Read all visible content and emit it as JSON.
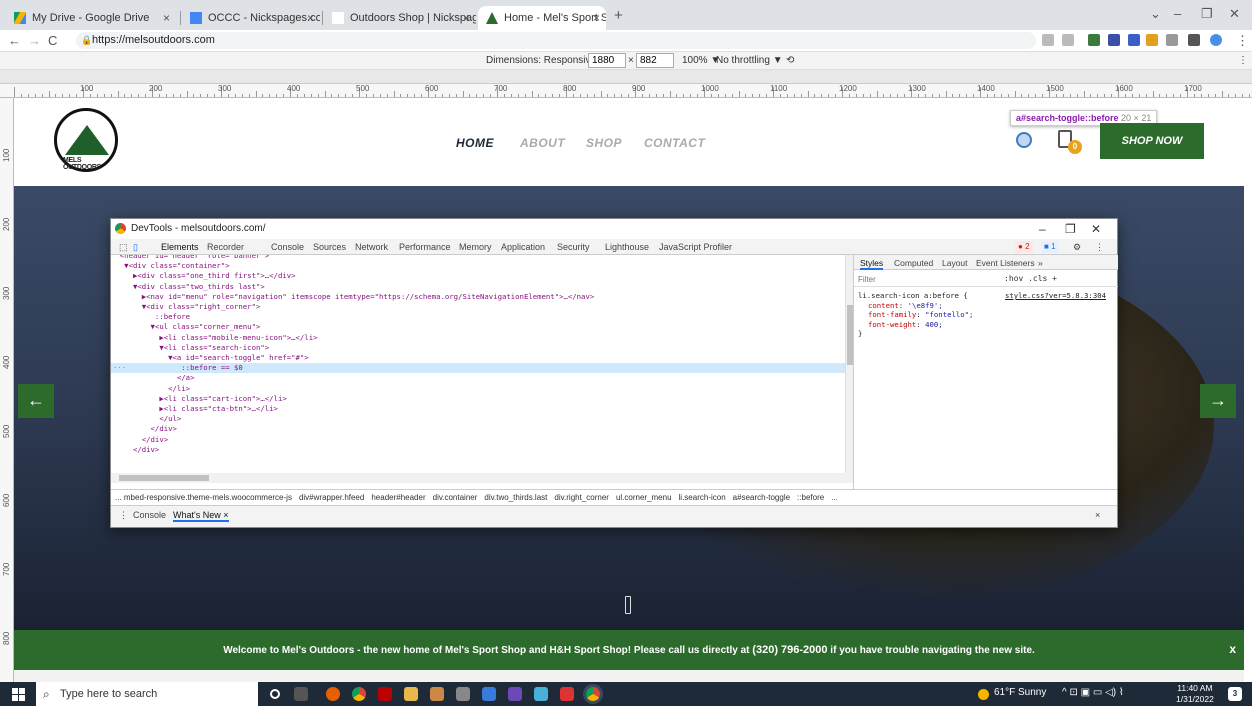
{
  "browser": {
    "tabs": [
      {
        "title": "My Drive - Google Drive",
        "close": "×"
      },
      {
        "title": "OCCC - Nickspages.com, Inc. - G",
        "close": "×"
      },
      {
        "title": "Outdoors Shop | Nickspages.com",
        "close": "×"
      },
      {
        "title": "Home - Mel's Sport Shop",
        "close": "×"
      }
    ],
    "new_tab": "+",
    "window_controls": {
      "dropdown": "⌄",
      "minimize": "–",
      "restore": "❐",
      "close": "✕"
    },
    "url": "https://melsoutdoors.com",
    "nav": {
      "back": "←",
      "forward": "→",
      "reload": "C"
    }
  },
  "device_toolbar": {
    "dimensions_label": "Dimensions: Responsive ▼",
    "width": "1880",
    "times": "×",
    "height": "882",
    "zoom": "100% ▼",
    "throttling": "No throttling ▼",
    "rotate": "⟲",
    "menu": "⋮"
  },
  "ruler": {
    "labels": [
      "100",
      "200",
      "300",
      "400",
      "500",
      "600",
      "700",
      "800",
      "900",
      "1000",
      "1100",
      "1200",
      "1300",
      "1400",
      "1500",
      "1600",
      "1700",
      "1800"
    ],
    "vlabels": [
      "100",
      "200",
      "300",
      "400",
      "500",
      "600",
      "700",
      "800",
      "900"
    ]
  },
  "site": {
    "logo_text": "MELS OUTDOORS",
    "nav": [
      {
        "label": "HOME"
      },
      {
        "label": "ABOUT"
      },
      {
        "label": "SHOP"
      },
      {
        "label": "CONTACT"
      }
    ],
    "cart_count": "0",
    "shop_now": "SHOP NOW",
    "tooltip_selector": "a#search-toggle::before",
    "tooltip_size": "20 × 21",
    "prev_arrow": "←",
    "next_arrow": "→",
    "banner_pre": "Welcome to Mel's Outdoors - the new home of Mel's Sport Shop and H&H Sport Shop! Please call us directly at ",
    "banner_phone": "(320) 796-2000",
    "banner_post": " if you have trouble navigating the new site.",
    "banner_close": "x"
  },
  "devtools": {
    "title": "DevTools - melsoutdoors.com/",
    "tabs": [
      "Elements",
      "Recorder",
      "Console",
      "Sources",
      "Network",
      "Performance",
      "Memory",
      "Application",
      "Security",
      "Lighthouse",
      "JavaScript Profiler"
    ],
    "errors": "2",
    "messages": "1",
    "dom_lines": [
      "  <header id=\"header\" role=\"banner\">",
      "   ▼<div class=\"container\">",
      "     ▶<div class=\"one_third first\">…</div>",
      "     ▼<div class=\"two_thirds last\">",
      "       ▶<nav id=\"menu\" role=\"navigation\" itemscope itemtype=\"https://schema.org/SiteNavigationElement\">…</nav>",
      "       ▼<div class=\"right_corner\">",
      "          ::before",
      "         ▼<ul class=\"corner_menu\">",
      "           ▶<li class=\"mobile-menu-icon\">…</li>",
      "           ▼<li class=\"search-icon\">",
      "             ▼<a id=\"search-toggle\" href=\"#\">",
      "                ::before == $0",
      "               </a>",
      "             </li>",
      "           ▶<li class=\"cart-icon\">…</li>",
      "           ▶<li class=\"cta-btn\">…</li>",
      "           </ul>",
      "         </div>",
      "       </div>",
      "     </div>"
    ],
    "gutter_dots": "···",
    "breadcrumbs": [
      "... mbed-responsive.theme-mels.woocommerce-js",
      "div#wrapper.hfeed",
      "header#header",
      "div.container",
      "div.two_thirds.last",
      "div.right_corner",
      "ul.corner_menu",
      "li.search-icon",
      "a#search-toggle",
      "::before",
      "..."
    ],
    "styles_tabs": [
      "Styles",
      "Computed",
      "Layout",
      "Event Listeners",
      "»"
    ],
    "filter_placeholder": "Filter",
    "filter_tools": ":hov  .cls  +",
    "rule_selector": "li.search-icon a:before {",
    "rule_source": "style.css?ver=5.8.3:304",
    "rule_props": [
      {
        "p": "content",
        "v": "'\\e8f9';"
      },
      {
        "p": "font-family",
        "v": "\"fontello\";"
      },
      {
        "p": "font-weight",
        "v": "400;"
      }
    ],
    "rule_close": "}",
    "drawer_tabs": [
      "Console",
      "What's New ×"
    ],
    "drawer_close": "×"
  },
  "taskbar": {
    "search_placeholder": "Type here to search",
    "weather": "61°F  Sunny",
    "time": "11:40 AM",
    "date": "1/31/2022",
    "notif": "3"
  },
  "colors": {
    "brand_green": "#2d6b2d",
    "cart_badge": "#e9a21b",
    "selection": "#cfe8fc"
  }
}
